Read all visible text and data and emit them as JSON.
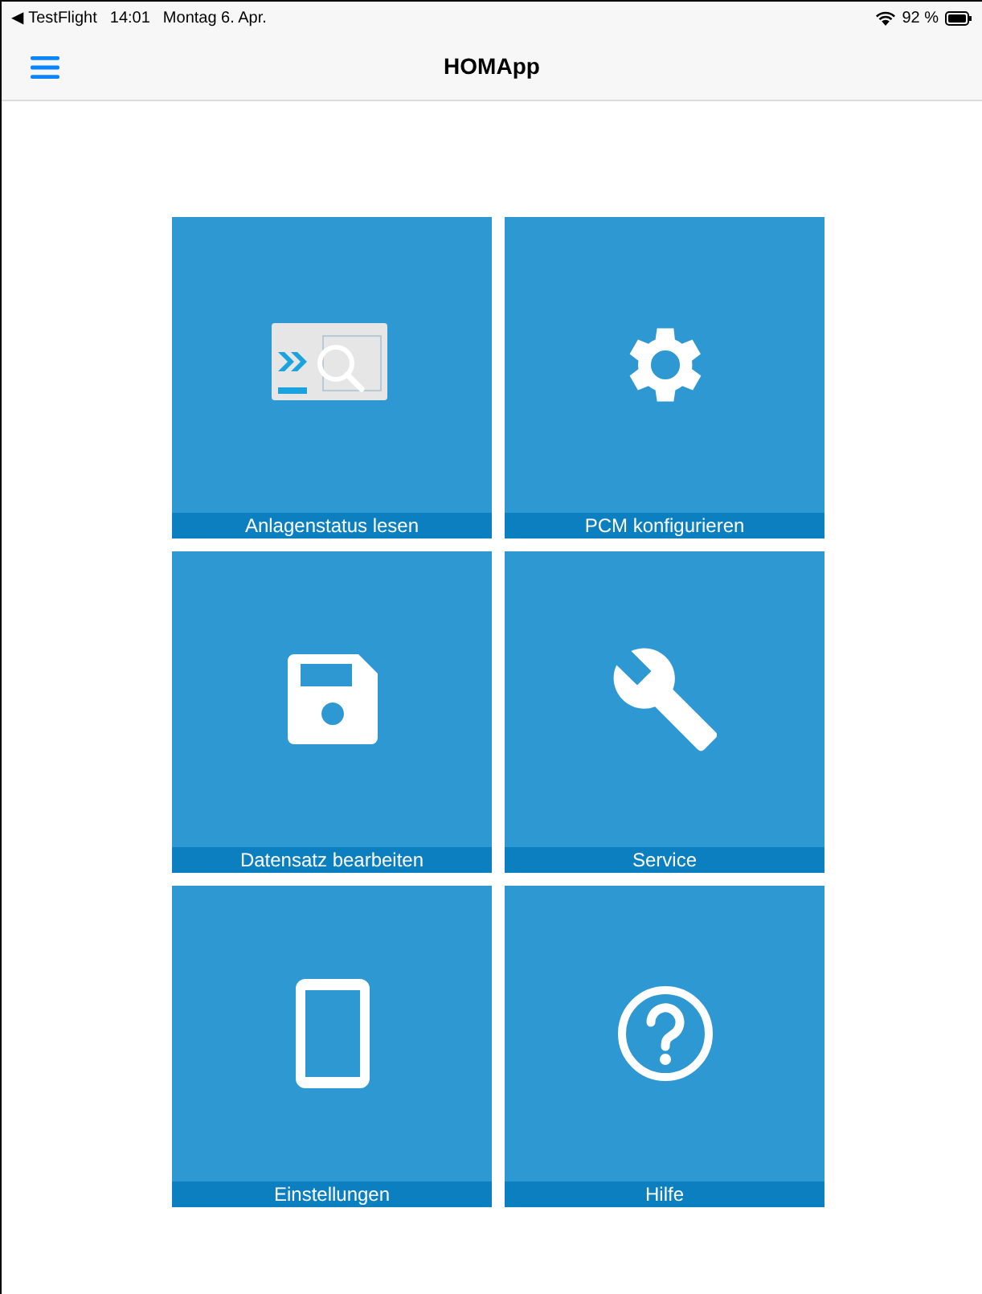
{
  "status_bar": {
    "back_app": "◀ TestFlight",
    "time": "14:01",
    "date": "Montag 6. Apr.",
    "battery": "92 %"
  },
  "nav_bar": {
    "title": "HOMApp"
  },
  "tiles": [
    {
      "label": "Anlagenstatus lesen",
      "kind": "device"
    },
    {
      "label": "PCM konfigurieren",
      "kind": "gear"
    },
    {
      "label": "Datensatz bearbeiten",
      "kind": "floppy"
    },
    {
      "label": "Service",
      "kind": "wrench"
    },
    {
      "label": "Einstellungen",
      "kind": "tablet"
    },
    {
      "label": "Hilfe",
      "kind": "help"
    }
  ]
}
